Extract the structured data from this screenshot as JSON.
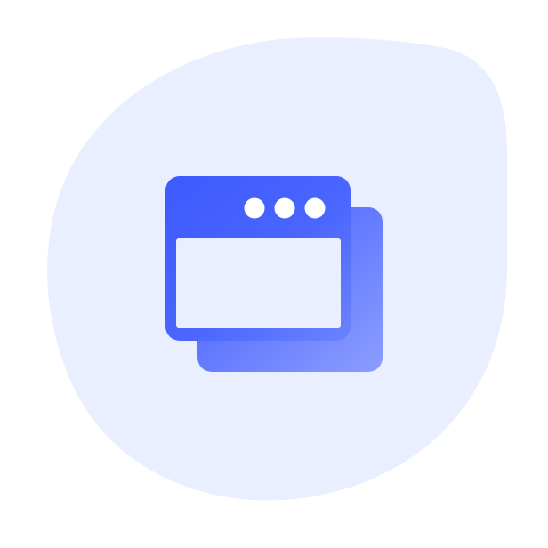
{
  "icon": {
    "name": "multiple-windows-icon",
    "colors": {
      "page_background": "#ffffff",
      "blob_background": "#e9efff",
      "accent_primary": "#3d5afe",
      "accent_light": "#8c9dff",
      "window_inner": "#e9efff",
      "dots": "#ffffff"
    }
  }
}
